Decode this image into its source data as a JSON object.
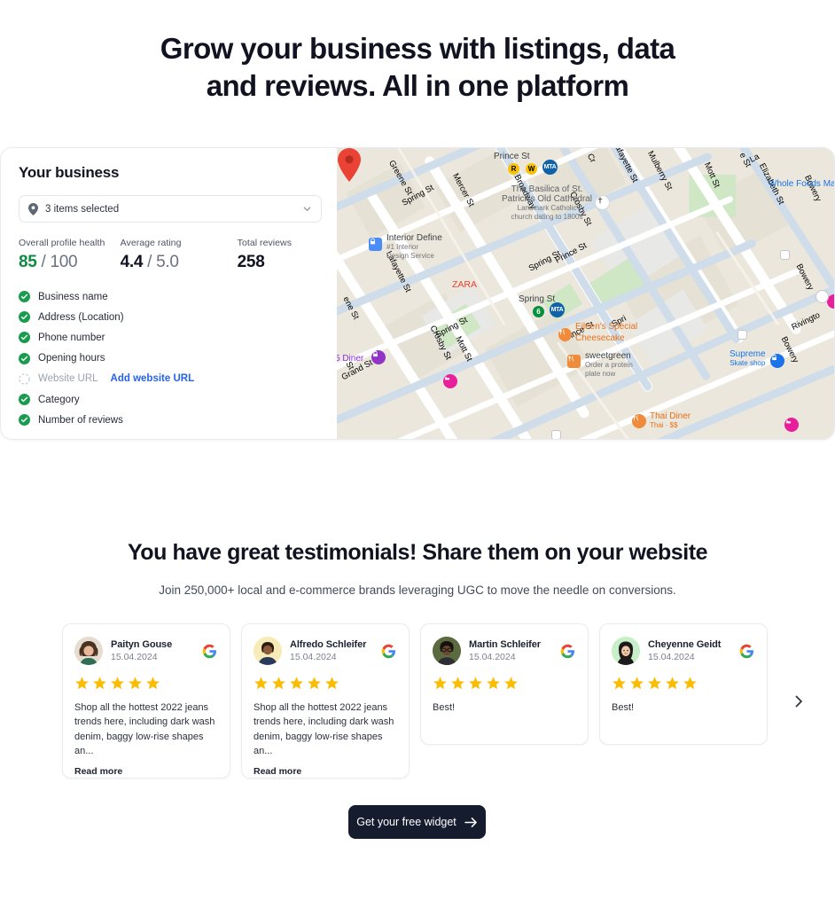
{
  "headline": {
    "line1": "Grow your business with listings, data",
    "line2": "and reviews. All in one platform"
  },
  "business_panel": {
    "title": "Your business",
    "selector": {
      "value": "3 items selected",
      "icon": "map-pin-icon",
      "chevron": "chevron-down-icon"
    },
    "stats": [
      {
        "caption": "Overall profile health",
        "value": "85",
        "suffix": " / 100",
        "color": "#0f8a43"
      },
      {
        "caption": "Average rating",
        "value": "4.4",
        "suffix": " / 5.0",
        "color": "#111420"
      },
      {
        "caption": "Total reviews",
        "value": "258",
        "suffix": "",
        "color": "#111420"
      }
    ],
    "checklist": [
      {
        "label": "Business name",
        "complete": true
      },
      {
        "label": "Address (Location)",
        "complete": true
      },
      {
        "label": "Phone number",
        "complete": true
      },
      {
        "label": "Opening hours",
        "complete": true
      },
      {
        "label": "Website URL",
        "complete": false,
        "action": "Add website URL"
      },
      {
        "label": "Category",
        "complete": true
      },
      {
        "label": "Number of reviews",
        "complete": true
      }
    ],
    "check_color": "#1a9c4e",
    "link_color": "#2563eb"
  },
  "map": {
    "marker_label": "ZARA",
    "streets": [
      "Greene St",
      "Spring St",
      "Mercer St",
      "Broadway",
      "Crosby St",
      "Prince St",
      "Lafayette St",
      "Mulberry St",
      "Mott St",
      "Elizabeth St",
      "Bowery",
      "Rivington",
      "Grand St",
      "ene St",
      "Cr",
      "La",
      "Mu",
      "e St",
      "Spri"
    ],
    "pois": [
      {
        "name": "Interior Define",
        "sub": "#1 Interior\nDesign Service",
        "style": "blue-icon"
      },
      {
        "name": "The Basilica of St.\nPatrick's Old Cathedral",
        "sub": "Landmark Catholic\nchurch dating to 1800s",
        "style": "gray"
      },
      {
        "name": "Whole Foods Mar",
        "sub": "",
        "style": "blue-text"
      },
      {
        "name": "Eileen's Special\nCheesecake",
        "sub": "",
        "style": "orange"
      },
      {
        "name": "sweetgreen",
        "sub": "Order a protein\nplate now",
        "style": "orange-gray"
      },
      {
        "name": "Supreme",
        "sub": "Skate shop",
        "style": "blue-text"
      },
      {
        "name": "Thai Diner",
        "sub": "Thai · $$",
        "style": "orange"
      },
      {
        "name": "5 Diner",
        "sub": "",
        "style": "purple"
      }
    ],
    "transit": [
      {
        "label": "R",
        "type": "subway-yellow"
      },
      {
        "label": "W",
        "type": "subway-yellow"
      },
      {
        "label": "6",
        "type": "subway-green"
      },
      {
        "label": "MTA",
        "type": "mta-blue"
      }
    ]
  },
  "testimonials": {
    "heading": "You have great testimonials! Share them on your website",
    "subheading": "Join 250,000+ local and e-commerce brands leveraging UGC to move the needle on conversions.",
    "read_more_label": "Read more",
    "next_label": "chevron-right-icon",
    "star_color": "#FBBC04",
    "cards": [
      {
        "name": "Paityn Gouse",
        "date": "15.04.2024",
        "rating": 5,
        "text": "Shop all the hottest 2022 jeans trends here, including dark wash denim, baggy low-rise shapes an...",
        "has_read_more": true,
        "source": "google",
        "avatar_bg": "#e9e2d6",
        "avatar_type": "photo-woman-curly"
      },
      {
        "name": "Alfredo Schleifer",
        "date": "15.04.2024",
        "rating": 5,
        "text": "Shop all the hottest 2022 jeans trends here, including dark wash denim, baggy low-rise shapes an...",
        "has_read_more": true,
        "source": "google",
        "avatar_bg": "#f7ecb8",
        "avatar_type": "photo-man-smiling"
      },
      {
        "name": "Martin Schleifer",
        "date": "15.04.2024",
        "rating": 5,
        "text": "Best!",
        "has_read_more": false,
        "source": "google",
        "avatar_bg": "#5c6b3f",
        "avatar_type": "photo-man-glasses"
      },
      {
        "name": "Cheyenne Geidt",
        "date": "15.04.2024",
        "rating": 5,
        "text": "Best!",
        "has_read_more": false,
        "source": "google",
        "avatar_bg": "#c8f0c8",
        "avatar_type": "memoji-woman"
      }
    ]
  },
  "cta": {
    "label": "Get your free widget",
    "icon": "arrow-right-icon",
    "bg": "#141c2e"
  }
}
